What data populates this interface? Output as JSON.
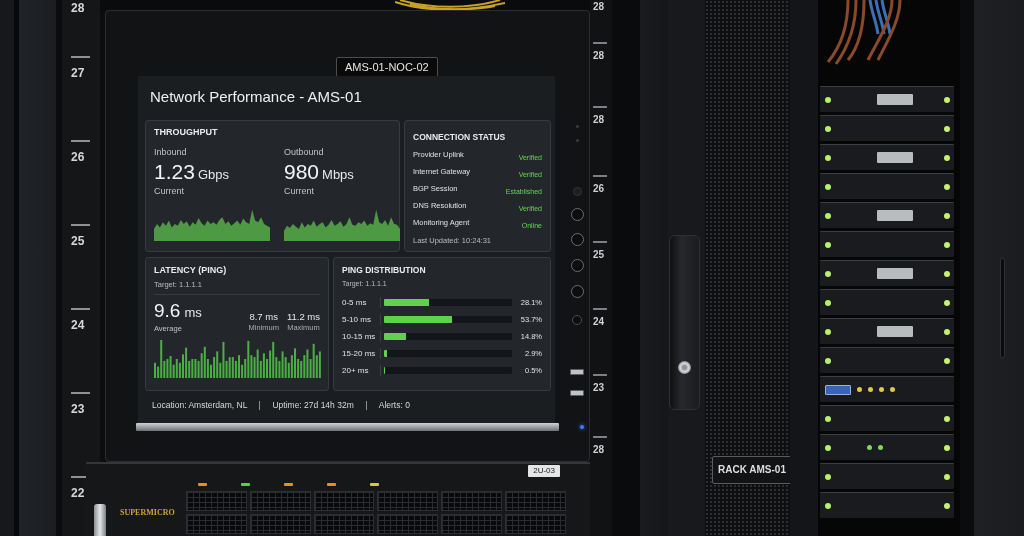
{
  "rack_rail_left": {
    "unit_numbers": [
      "28",
      "27",
      "26",
      "25",
      "24",
      "23",
      "22"
    ]
  },
  "monitor": {
    "asset_label": "AMS-01-NOC-02"
  },
  "dashboard": {
    "title": "Network Performance - AMS-01",
    "throughput": {
      "title": "THROUGHPUT",
      "metrics": [
        {
          "label": "Inbound",
          "value": "1.23",
          "unit": "Gbps",
          "caption": "Current"
        },
        {
          "label": "Outbound",
          "value": "980",
          "unit": "Mbps",
          "caption": "Current"
        }
      ]
    },
    "connection_status": {
      "title": "CONNECTION STATUS",
      "items": [
        {
          "name": "Provider Uplink",
          "status": "Verified"
        },
        {
          "name": "Internet Gateway",
          "status": "Verified"
        },
        {
          "name": "BGP Session",
          "status": "Established"
        },
        {
          "name": "DNS Resolution",
          "status": "Verified"
        },
        {
          "name": "Monitoring Agent",
          "status": "Online"
        }
      ],
      "last_updated": "Last Updated: 10:24:31"
    },
    "latency": {
      "title": "LATENCY (PING)",
      "target": "Target: 1.1.1.1",
      "average": {
        "value": "9.6",
        "unit": "ms",
        "caption": "Average"
      },
      "stats": [
        {
          "value": "8.7 ms",
          "caption": "Minimum"
        },
        {
          "value": "11.2 ms",
          "caption": "Maximum"
        }
      ]
    },
    "ping_distribution": {
      "title": "PING DISTRIBUTION",
      "target": "Target: 1.1.1.1",
      "rows": [
        {
          "label": "0-5 ms",
          "level": 0.35,
          "value": "28.1%"
        },
        {
          "label": "5-10 ms",
          "level": 0.53,
          "value": "53.7%"
        },
        {
          "label": "10-15 ms",
          "level": 0.17,
          "value": "14.8%"
        },
        {
          "label": "15-20 ms",
          "level": 0.02,
          "value": "2.9%"
        },
        {
          "label": "20+ ms",
          "level": 0.005,
          "value": "0.5%"
        }
      ]
    },
    "status_bar": [
      "Location: Amsterdam, NL",
      "Uptime: 27d 14h 32m",
      "Alerts: 0"
    ]
  },
  "rack_rail_right": {
    "unit_numbers": [
      "28",
      "28",
      "28",
      "26",
      "25",
      "24",
      "23",
      "28"
    ]
  },
  "server": {
    "brand": "SUPERMICRO",
    "asset_label": "2U-03"
  },
  "rack_door": {
    "label": "RACK AMS-01"
  }
}
